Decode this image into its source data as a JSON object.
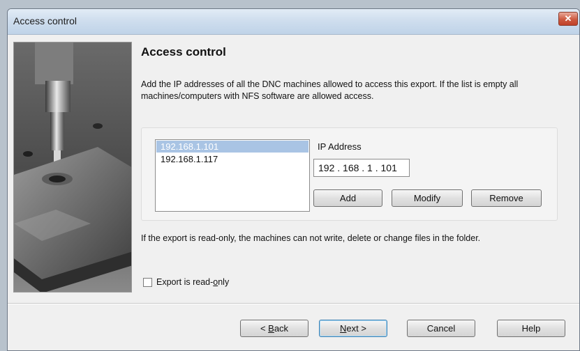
{
  "window": {
    "title": "Access control",
    "close_glyph": "✕"
  },
  "page": {
    "title": "Access control",
    "description": "Add the IP addresses of all the DNC machines allowed to access this export. If the list is empty all machines/computers with NFS software are allowed access."
  },
  "ip_list": {
    "items": [
      "192.168.1.101",
      "192.168.1.117"
    ],
    "selected_index": 0
  },
  "ip_address": {
    "label": "IP Address",
    "value": "192 . 168 .  1  . 101"
  },
  "ip_buttons": {
    "add": "Add",
    "modify": "Modify",
    "remove": "Remove"
  },
  "readonly_note": "If the export is read-only, the machines can not write, delete or change files in the folder.",
  "readonly_checkbox": {
    "label_pre": "Export is read-",
    "label_accel": "o",
    "label_post": "nly",
    "checked": false
  },
  "nav_buttons": {
    "back_pre": "< ",
    "back_accel": "B",
    "back_post": "ack",
    "next_accel": "N",
    "next_post": "ext >",
    "cancel": "Cancel",
    "help": "Help"
  },
  "icons": {
    "side_image": "cnc-milling-machine-image"
  }
}
